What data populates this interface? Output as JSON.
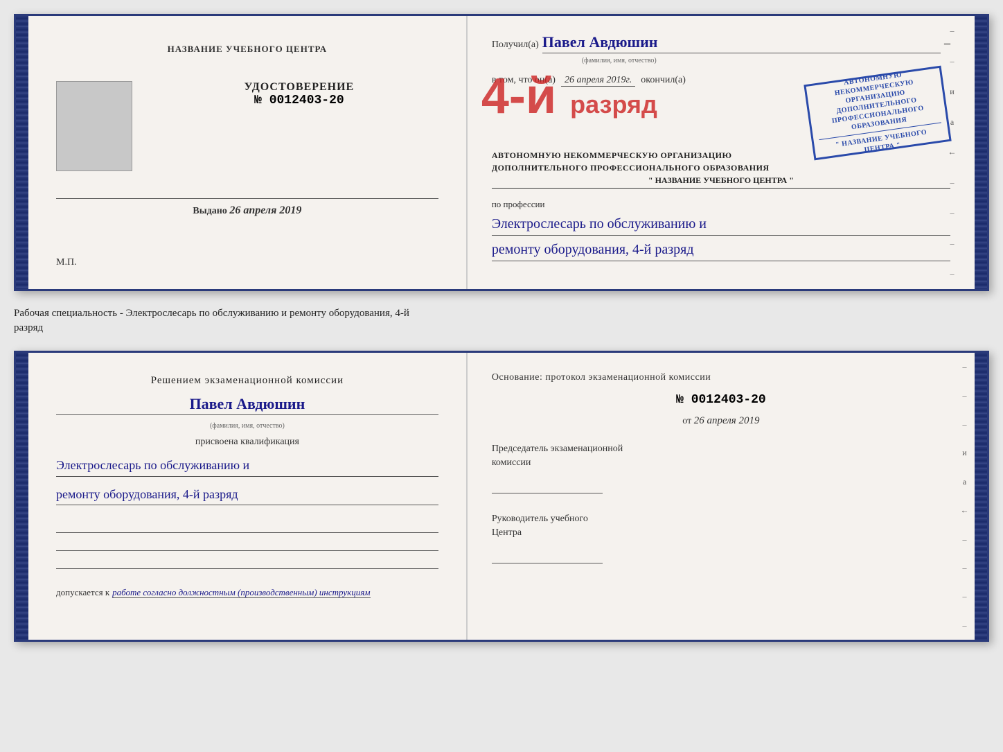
{
  "page": {
    "background": "#e8e8e8"
  },
  "subtitle": {
    "text": "Рабочая специальность - Электрослесарь по обслуживанию и ремонту оборудования, 4-й\nразряд"
  },
  "top_document": {
    "left": {
      "center_name": "НАЗВАНИЕ УЧЕБНОГО ЦЕНТРА",
      "cert_title": "УДОСТОВЕРЕНИЕ",
      "cert_number": "№ 0012403-20",
      "issued_label": "Выдано",
      "issued_date": "26 апреля 2019",
      "mp_label": "М.П."
    },
    "right": {
      "recipient_label": "Получил(а)",
      "recipient_name": "Павел Авдюшин",
      "recipient_subtitle": "(фамилия, имя, отчество)",
      "recipient_dash": "–",
      "vtom_label": "в том, что он(а)",
      "vtom_date": "26 апреля 2019г.",
      "okonchil_label": "окончил(а)",
      "grade": "4-й",
      "org_line1": "АВТОНОМНУЮ НЕКОММЕРЧЕСКУЮ ОРГАНИЗАЦИЮ",
      "org_line2": "ДОПОЛНИТЕЛЬНОГО ПРОФЕССИОНАЛЬНОГО ОБРАЗОВАНИЯ",
      "org_name": "\" НАЗВАНИЕ УЧЕБНОГО ЦЕНТРА \"",
      "profession_label": "по профессии",
      "profession_line1": "Электрослесарь по обслуживанию и",
      "profession_line2": "ремонту оборудования, 4-й разряд"
    }
  },
  "bottom_document": {
    "left": {
      "komissia_line1": "Решением экзаменационной комиссии",
      "person_name": "Павел Авдюшин",
      "person_subtitle": "(фамилия, имя, отчество)",
      "prisvoena_label": "присвоена квалификация",
      "qualification_line1": "Электрослесарь по обслуживанию и",
      "qualification_line2": "ремонту оборудования, 4-й разряд",
      "dopuskaetsya_label": "допускается к",
      "dopuskaetsya_value": "работе согласно должностным (производственным) инструкциям"
    },
    "right": {
      "osnovanie_text": "Основание: протокол экзаменационной комиссии",
      "protocol_number": "№ 0012403-20",
      "protocol_date_prefix": "от",
      "protocol_date": "26 апреля 2019",
      "predsedatel_line1": "Председатель экзаменационной",
      "predsedatel_line2": "комиссии",
      "rukovoditel_line1": "Руководитель учебного",
      "rukovoditel_line2": "Центра"
    }
  }
}
